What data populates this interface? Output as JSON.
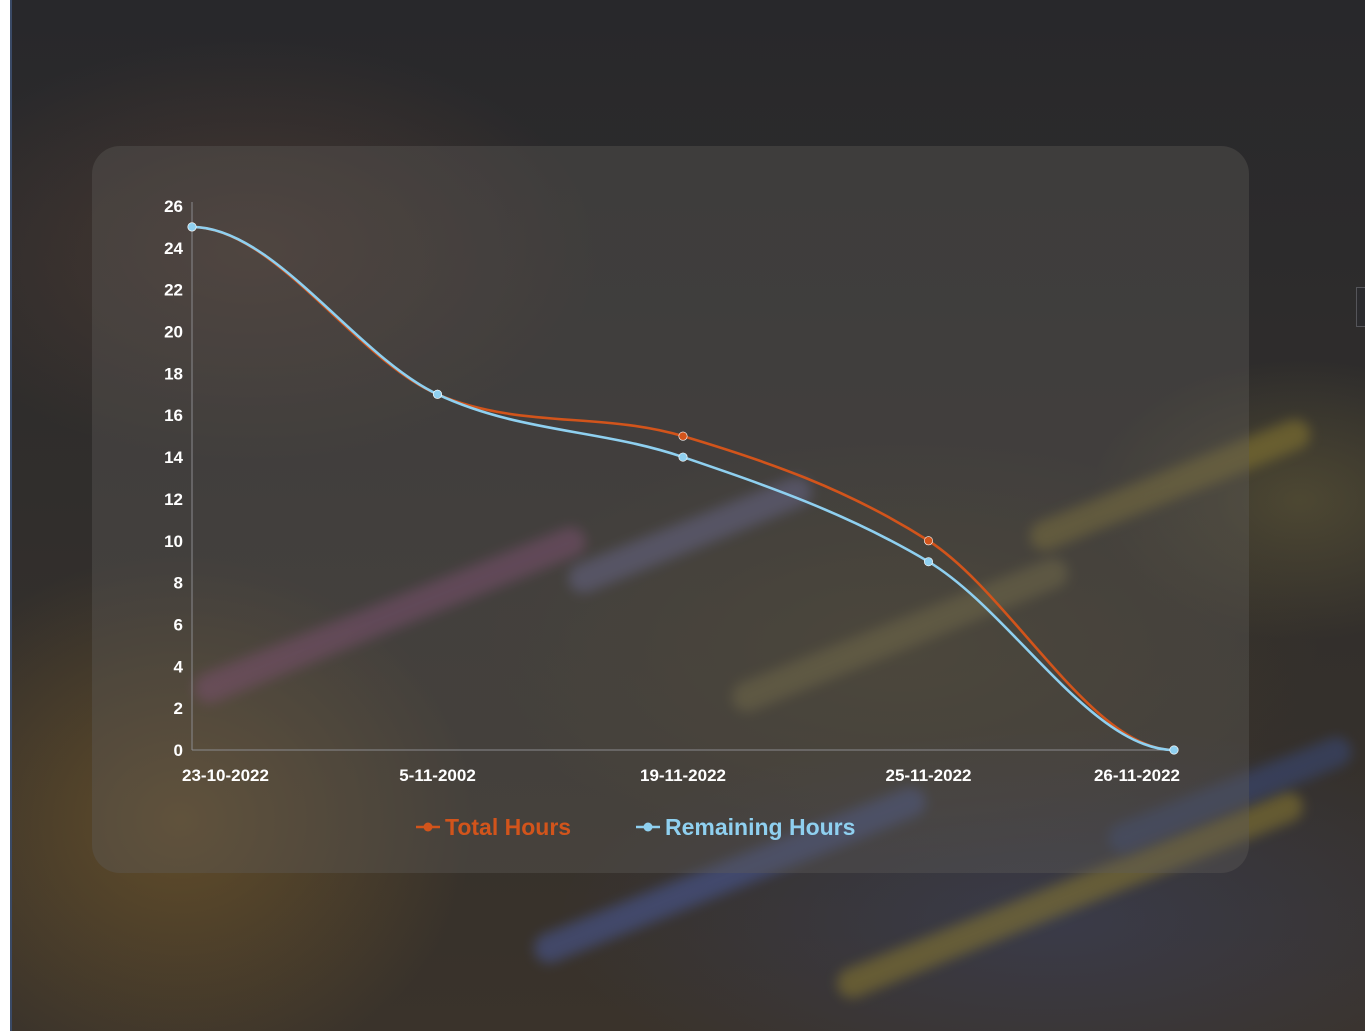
{
  "chart_data": {
    "type": "line",
    "categories": [
      "23-10-2022",
      "5-11-2002",
      "19-11-2022",
      "25-11-2022",
      "26-11-2022"
    ],
    "series": [
      {
        "name": "Total Hours",
        "color": "#d2541b",
        "values": [
          25,
          17,
          15,
          10,
          0
        ]
      },
      {
        "name": "Remaining Hours",
        "color": "#8fd0f0",
        "values": [
          25,
          17,
          14,
          9,
          0
        ]
      }
    ],
    "yticks": [
      0,
      2,
      4,
      6,
      8,
      10,
      12,
      14,
      16,
      18,
      20,
      22,
      24,
      26
    ],
    "ylim": [
      0,
      26
    ],
    "grid": false,
    "legend_position": "bottom",
    "line_style": "smooth"
  }
}
